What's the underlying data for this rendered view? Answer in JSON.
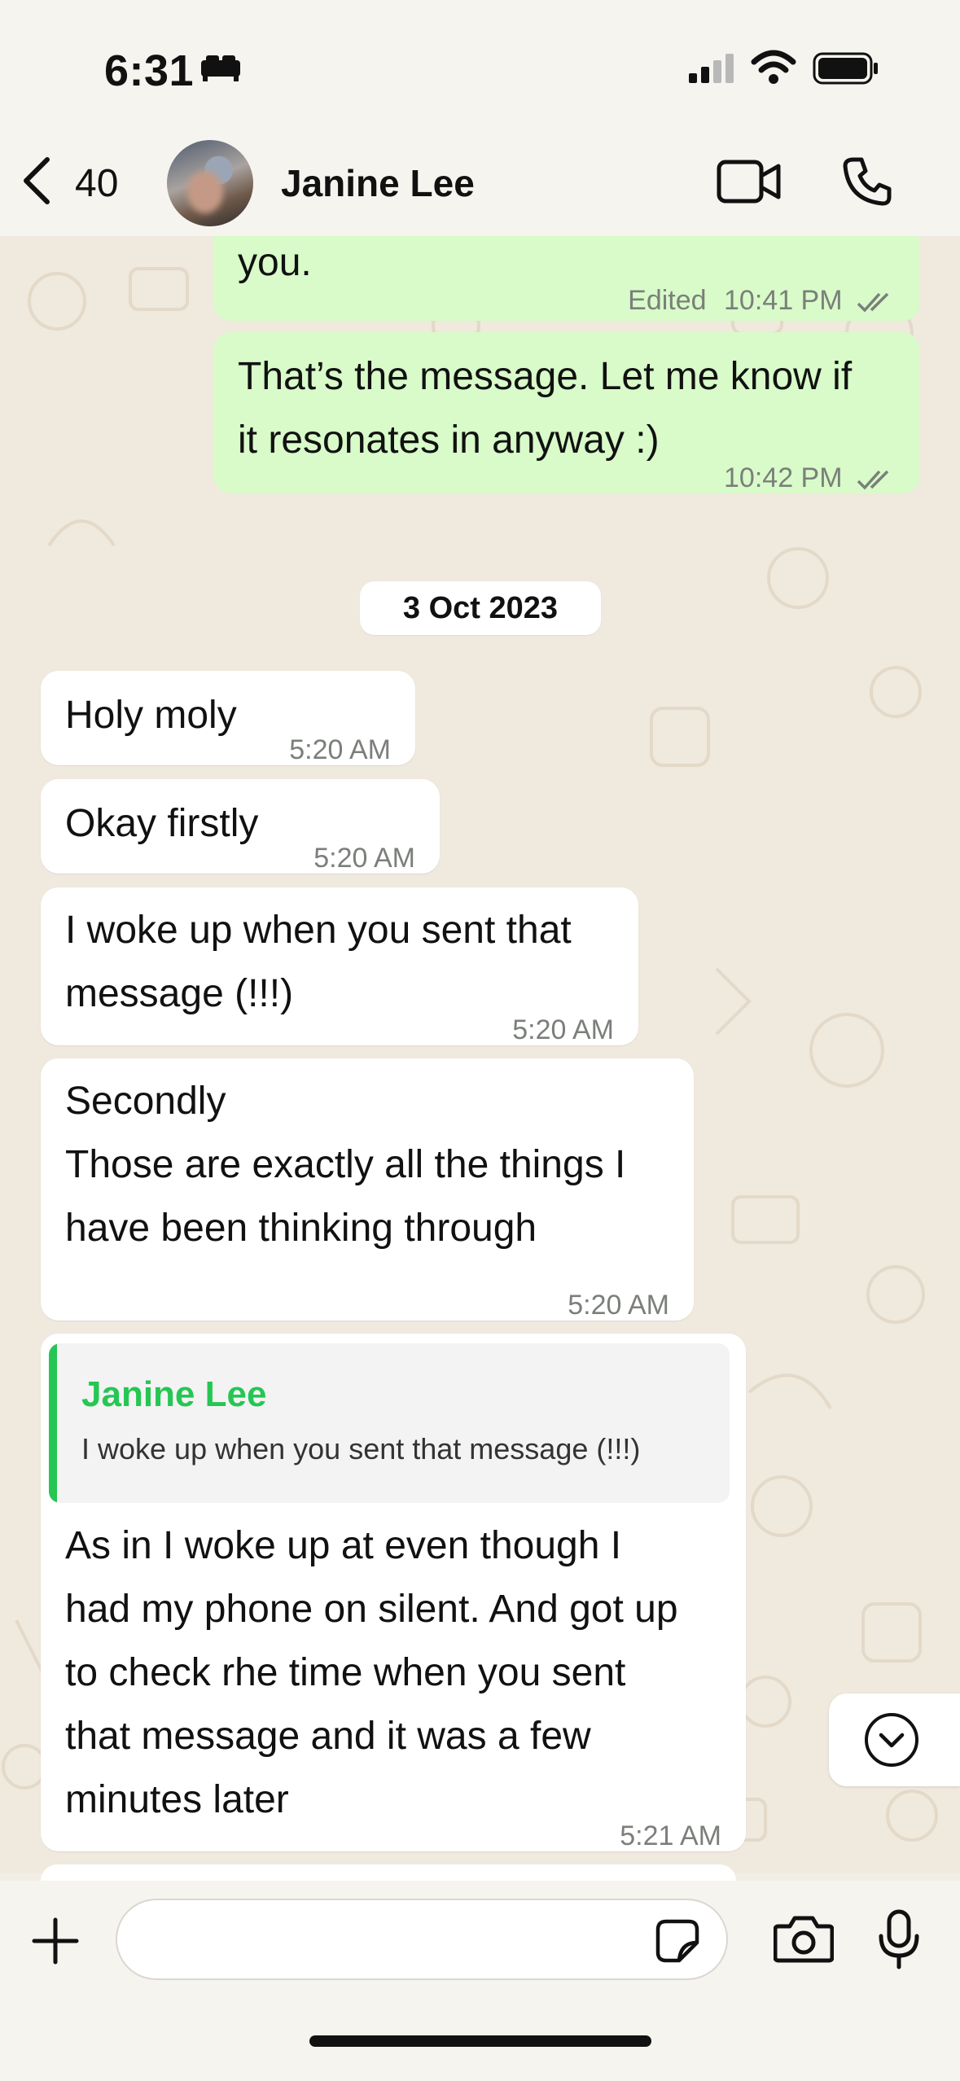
{
  "status_bar": {
    "time": "6:31"
  },
  "header": {
    "back_count": "40",
    "contact_name": "Janine Lee"
  },
  "messages": [
    {
      "dir": "out",
      "text": "you.",
      "edited": "Edited",
      "time": "10:41 PM"
    },
    {
      "dir": "out",
      "text": "That’s the message. Let me know if\nit resonates in anyway :)",
      "time": "10:42 PM"
    },
    {
      "dir": "in",
      "text": "Holy moly",
      "time": "5:20 AM"
    },
    {
      "dir": "in",
      "text": "Okay firstly",
      "time": "5:20 AM"
    },
    {
      "dir": "in",
      "text": "I woke up when you sent that\nmessage (!!!)",
      "time": "5:20 AM"
    },
    {
      "dir": "in",
      "text": "Secondly\nThose are exactly all the things I\nhave been thinking through",
      "time": "5:20 AM"
    },
    {
      "dir": "in",
      "quote": {
        "name": "Janine Lee",
        "text": "I woke up when you sent that message (!!!)"
      },
      "text": "As in I woke up at even though I\nhad my phone on silent. And got up\nto check rhe time when you sent\nthat message and it was a few\nminutes later",
      "time": "5:21 AM"
    }
  ],
  "date_separator": "3 Oct 2023",
  "composer": {
    "placeholder": ""
  },
  "colors": {
    "outgoing": "#d8fbc9",
    "incoming": "#ffffff",
    "accent": "#25c653",
    "tick": "#7b7f7a"
  },
  "icons": [
    "bed-icon",
    "signal-icon",
    "wifi-icon",
    "battery-icon",
    "back-chevron-icon",
    "video-call-icon",
    "phone-icon",
    "double-check-icon",
    "chevron-down-icon",
    "plus-icon",
    "sticker-icon",
    "camera-icon",
    "microphone-icon"
  ]
}
